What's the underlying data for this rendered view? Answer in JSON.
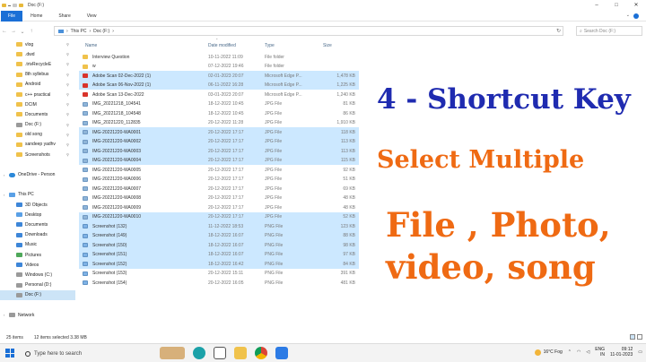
{
  "window": {
    "title": "Doc (F:)",
    "controls": [
      "–",
      "□",
      "✕"
    ]
  },
  "ribbon": {
    "tabs": [
      "File",
      "Home",
      "Share",
      "View"
    ]
  },
  "address": {
    "path": [
      "This PC",
      "Doc (F:)"
    ],
    "search_placeholder": "Search Doc (F:)"
  },
  "nav": {
    "items": [
      {
        "label": "vlog",
        "icon": "folder-icon"
      },
      {
        "label": ".dwd",
        "icon": "folder-icon"
      },
      {
        "label": ".trivRecycleE",
        "icon": "folder-icon"
      },
      {
        "label": "8th syllebus",
        "icon": "folder-icon"
      },
      {
        "label": "Android",
        "icon": "folder-icon"
      },
      {
        "label": "c++ practical",
        "icon": "folder-icon"
      },
      {
        "label": "DCIM",
        "icon": "folder-icon"
      },
      {
        "label": "Documents",
        "icon": "folder-icon"
      },
      {
        "label": "Doc (F:)",
        "icon": "drive-icon"
      },
      {
        "label": "old song",
        "icon": "folder-icon"
      },
      {
        "label": "sandeep yadhv",
        "icon": "folder-icon"
      },
      {
        "label": "Screenshots",
        "icon": "folder-icon"
      },
      {
        "label": "",
        "icon": ""
      },
      {
        "label": "OneDrive - Person",
        "icon": "cloud-icon",
        "top": true
      },
      {
        "label": "",
        "icon": ""
      },
      {
        "label": "This PC",
        "icon": "pc-icon",
        "top": true
      },
      {
        "label": "3D Objects",
        "icon": "objects-icon"
      },
      {
        "label": "Desktop",
        "icon": "desktop-icon"
      },
      {
        "label": "Documents",
        "icon": "documents-icon"
      },
      {
        "label": "Downloads",
        "icon": "downloads-icon"
      },
      {
        "label": "Music",
        "icon": "music-icon"
      },
      {
        "label": "Pictures",
        "icon": "pictures-icon"
      },
      {
        "label": "Videos",
        "icon": "videos-icon"
      },
      {
        "label": "Windows (C:)",
        "icon": "drive-icon"
      },
      {
        "label": "Personal (D:)",
        "icon": "drive-icon"
      },
      {
        "label": "Doc (F:)",
        "icon": "drive-icon",
        "selected": true
      },
      {
        "label": "",
        "icon": ""
      },
      {
        "label": "Network",
        "icon": "network-icon",
        "top": true
      }
    ]
  },
  "columns": {
    "name": "Name",
    "date": "Date modified",
    "type": "Type",
    "size": "Size"
  },
  "files": [
    {
      "name": "Interview Question",
      "date": "10-11-2022 11:09",
      "type": "File folder",
      "size": "",
      "kind": "folder",
      "selected": false
    },
    {
      "name": "w",
      "date": "07-12-2022 19:46",
      "type": "File folder",
      "size": "",
      "kind": "folder",
      "selected": false
    },
    {
      "name": "Adobe Scan 02-Dec-2022 (1)",
      "date": "02-01-2023 20:07",
      "type": "Microsoft Edge P...",
      "size": "1,478 KB",
      "kind": "pdf",
      "selected": true
    },
    {
      "name": "Adobe Scan 06-Nov-2022 (1)",
      "date": "06-11-2022 16:28",
      "type": "Microsoft Edge P...",
      "size": "1,225 KB",
      "kind": "pdf",
      "selected": true
    },
    {
      "name": "Adobe Scan 13-Dec-2022",
      "date": "03-01-2023 20:07",
      "type": "Microsoft Edge P...",
      "size": "1,240 KB",
      "kind": "pdf",
      "selected": false
    },
    {
      "name": "IMG_20221218_104541",
      "date": "18-12-2022 10:45",
      "type": "JPG File",
      "size": "81 KB",
      "kind": "jpg",
      "selected": false
    },
    {
      "name": "IMG_20221218_104548",
      "date": "18-12-2022 10:45",
      "type": "JPG File",
      "size": "86 KB",
      "kind": "jpg",
      "selected": false
    },
    {
      "name": "IMG_20221220_112835",
      "date": "20-12-2022 11:28",
      "type": "JPG File",
      "size": "1,910 KB",
      "kind": "jpg",
      "selected": false
    },
    {
      "name": "IMG-20221220-WA0001",
      "date": "20-12-2022 17:17",
      "type": "JPG File",
      "size": "118 KB",
      "kind": "jpg",
      "selected": true
    },
    {
      "name": "IMG-20221220-WA0002",
      "date": "20-12-2022 17:17",
      "type": "JPG File",
      "size": "113 KB",
      "kind": "jpg",
      "selected": true
    },
    {
      "name": "IMG-20221220-WA0003",
      "date": "20-12-2022 17:17",
      "type": "JPG File",
      "size": "113 KB",
      "kind": "jpg",
      "selected": true
    },
    {
      "name": "IMG-20221220-WA0004",
      "date": "20-12-2022 17:17",
      "type": "JPG File",
      "size": "115 KB",
      "kind": "jpg",
      "selected": true
    },
    {
      "name": "IMG-20221220-WA0005",
      "date": "20-12-2022 17:17",
      "type": "JPG File",
      "size": "92 KB",
      "kind": "jpg",
      "selected": false
    },
    {
      "name": "IMG-20221220-WA0006",
      "date": "20-12-2022 17:17",
      "type": "JPG File",
      "size": "51 KB",
      "kind": "jpg",
      "selected": false
    },
    {
      "name": "IMG-20221220-WA0007",
      "date": "20-12-2022 17:17",
      "type": "JPG File",
      "size": "69 KB",
      "kind": "jpg",
      "selected": false
    },
    {
      "name": "IMG-20221220-WA0008",
      "date": "20-12-2022 17:17",
      "type": "JPG File",
      "size": "48 KB",
      "kind": "jpg",
      "selected": false
    },
    {
      "name": "IMG-20221220-WA0009",
      "date": "20-12-2022 17:17",
      "type": "JPG File",
      "size": "48 KB",
      "kind": "jpg",
      "selected": false
    },
    {
      "name": "IMG-20221220-WA0010",
      "date": "20-12-2022 17:17",
      "type": "JPG File",
      "size": "52 KB",
      "kind": "jpg",
      "selected": true
    },
    {
      "name": "Screenshot (132)",
      "date": "11-12-2022 18:53",
      "type": "PNG File",
      "size": "123 KB",
      "kind": "png",
      "selected": true
    },
    {
      "name": "Screenshot (149)",
      "date": "18-12-2022 16:07",
      "type": "PNG File",
      "size": "88 KB",
      "kind": "png",
      "selected": true
    },
    {
      "name": "Screenshot (150)",
      "date": "18-12-2022 16:07",
      "type": "PNG File",
      "size": "98 KB",
      "kind": "png",
      "selected": true
    },
    {
      "name": "Screenshot (151)",
      "date": "18-12-2022 16:07",
      "type": "PNG File",
      "size": "97 KB",
      "kind": "png",
      "selected": true
    },
    {
      "name": "Screenshot (152)",
      "date": "18-12-2022 16:42",
      "type": "PNG File",
      "size": "84 KB",
      "kind": "png",
      "selected": true
    },
    {
      "name": "Screenshot (153)",
      "date": "20-12-2022 15:11",
      "type": "PNG File",
      "size": "391 KB",
      "kind": "png",
      "selected": false
    },
    {
      "name": "Screenshot (154)",
      "date": "20-12-2022 16:05",
      "type": "PNG File",
      "size": "481 KB",
      "kind": "png",
      "selected": false
    }
  ],
  "overlay": {
    "line1": "4 - Shortcut Key",
    "line2": "Select Multiple",
    "line3": "File , Photo,",
    "line4": "video, song"
  },
  "status": {
    "count": "25 items",
    "selected": "12 items selected  3.38 MB"
  },
  "taskbar": {
    "search": "Type here to search",
    "weather": "16°C  Fog",
    "lang": "ENG",
    "region": "IN",
    "time": "09:12",
    "date": "11-01-2023"
  },
  "colors": {
    "selection": "#cce8ff",
    "overlay_blue": "#1f2bb0",
    "overlay_orange": "#ef6a13",
    "file_tab": "#1a6fd6"
  }
}
